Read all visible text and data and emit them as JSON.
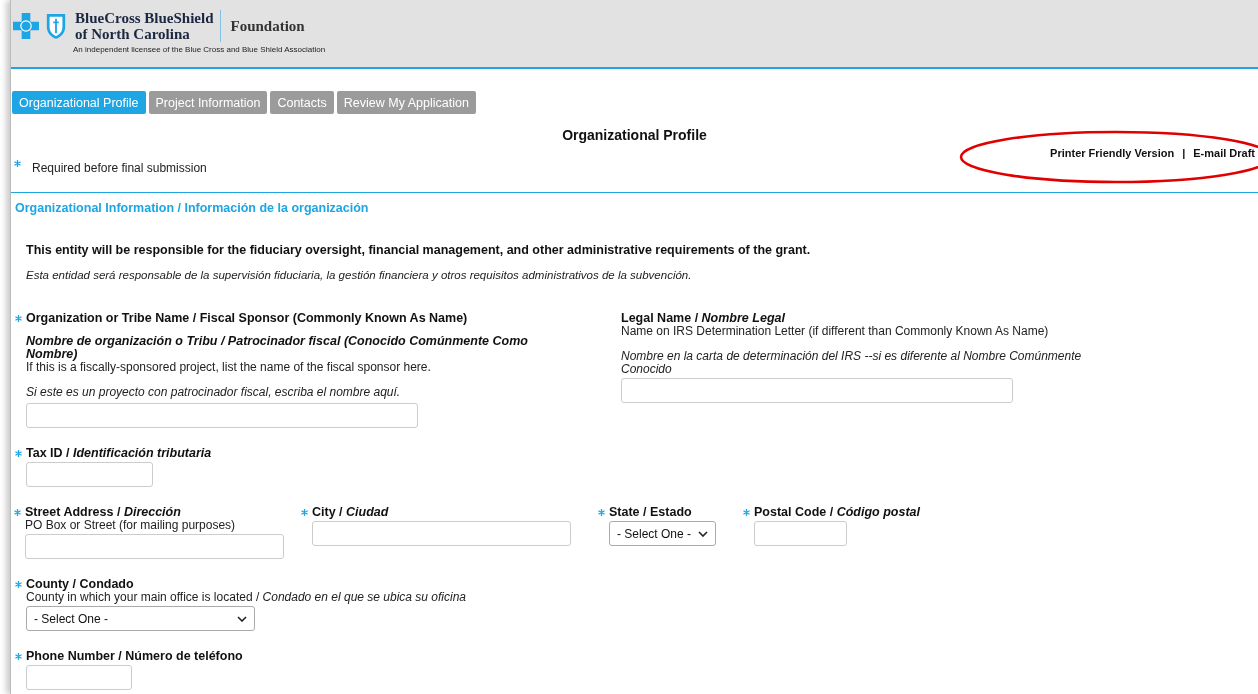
{
  "header": {
    "brand_line_1": "BlueCross BlueShield",
    "brand_line_2": "of North Carolina",
    "foundation": "Foundation",
    "tagline": "An independent licensee of the Blue Cross and Blue Shield Association"
  },
  "tabs": [
    {
      "label": "Organizational Profile",
      "selected": true
    },
    {
      "label": "Project Information",
      "selected": false
    },
    {
      "label": "Contacts",
      "selected": false
    },
    {
      "label": "Review My Application",
      "selected": false
    }
  ],
  "page_title": "Organizational Profile",
  "links": [
    "Printer Friendly Version",
    "E-mail Draft"
  ],
  "link_separator": "|",
  "required_note": "Required before final submission",
  "section_title": "Organizational Information / Información de la organización",
  "intro": "This entity will be responsible for the fiduciary oversight, financial management, and other administrative requirements of the grant.",
  "intro_es": "Esta entidad será responsable de la supervisión fiduciaria, la gestión financiera y otros requisitos administrativos de la subvención.",
  "rows": [
    [
      {
        "label": "Organization or Tribe Name / Fiscal Sponsor (Commonly Known As Name)",
        "label_es": "Nombre de organización o Tribu / Patrocinador fiscal (Conocido Comúnmente Como Nombre)",
        "required": true,
        "notes": [
          {
            "text": "If this is a fiscally-sponsored project, list the name of the fiscal sponsor here.",
            "italic": false
          },
          {
            "text": "Si este es un proyecto con patrocinador fiscal, escriba el nombre aquí.",
            "italic": true
          }
        ],
        "control": {
          "kind": "text"
        }
      },
      {
        "label": "Legal Name / *Nombre Legal*",
        "required": false,
        "notes": [
          {
            "text": "Name on IRS Determination Letter (if different than Commonly Known As Name)",
            "italic": false
          },
          {
            "text": "Nombre en la carta de determinación del IRS --si es diferente al Nombre Comúnmente Conocido",
            "italic": true
          }
        ],
        "control": {
          "kind": "text"
        }
      }
    ],
    [
      {
        "label": "Tax ID / *Identificación tributaria*",
        "required": true,
        "control": {
          "kind": "text"
        }
      }
    ],
    [
      {
        "label": "Street Address / *Dirección*",
        "required": true,
        "notes": [
          {
            "text": "PO Box or Street (for mailing purposes)",
            "italic": false
          }
        ],
        "control": {
          "kind": "text"
        }
      },
      {
        "label": "City / *Ciudad*",
        "required": true,
        "control": {
          "kind": "text"
        }
      },
      {
        "label": "State / Estado",
        "required": true,
        "control": {
          "kind": "select",
          "value": "- Select One -"
        }
      },
      {
        "label": "Postal Code / *Código postal*",
        "required": true,
        "control": {
          "kind": "text"
        }
      }
    ],
    [
      {
        "label": "County / Condado",
        "required": true,
        "notes": [
          {
            "text": "County in which your main office is located / *Condado en el que se ubica su oficina*",
            "italic": false
          }
        ],
        "control": {
          "kind": "select",
          "value": "- Select One -"
        }
      }
    ],
    [
      {
        "label": "Phone Number / Número de teléfono",
        "required": true,
        "control": {
          "kind": "text"
        }
      }
    ]
  ]
}
